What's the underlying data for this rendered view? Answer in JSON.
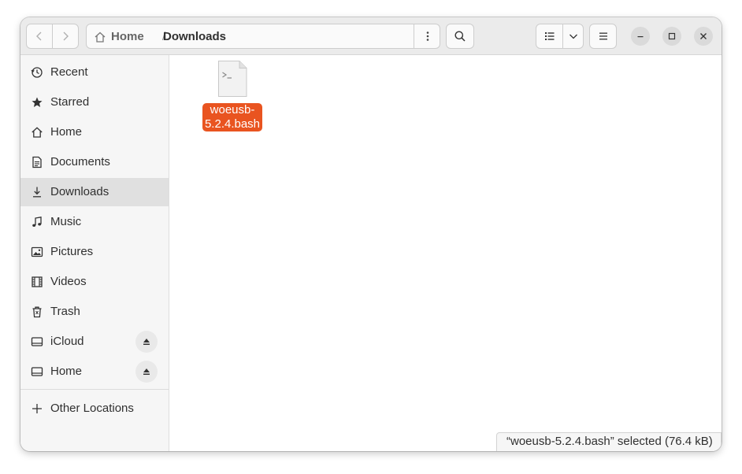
{
  "window": {
    "path": [
      "Home",
      "Downloads"
    ],
    "path_separator": "/"
  },
  "sidebar": {
    "items": [
      {
        "label": "Recent",
        "icon": "clock-icon"
      },
      {
        "label": "Starred",
        "icon": "star-icon"
      },
      {
        "label": "Home",
        "icon": "home-icon"
      },
      {
        "label": "Documents",
        "icon": "document-icon"
      },
      {
        "label": "Downloads",
        "icon": "download-icon",
        "selected": true
      },
      {
        "label": "Music",
        "icon": "music-note-icon"
      },
      {
        "label": "Pictures",
        "icon": "image-icon"
      },
      {
        "label": "Videos",
        "icon": "film-icon"
      },
      {
        "label": "Trash",
        "icon": "trash-icon"
      },
      {
        "label": "iCloud",
        "icon": "drive-icon",
        "ejectable": true
      },
      {
        "label": "Home",
        "icon": "drive-icon",
        "ejectable": true
      }
    ],
    "other_locations": {
      "label": "Other Locations",
      "icon": "plus-icon"
    }
  },
  "files": [
    {
      "name_lines": [
        "woeusb-",
        "5.2.4.bash"
      ],
      "icon": "terminal-script-icon",
      "selected": true
    }
  ],
  "status": {
    "text": "“woeusb-5.2.4.bash” selected  (76.4 kB)"
  },
  "colors": {
    "accent": "#e95420",
    "headerbar": "#ebebeb",
    "sidebar": "#f6f6f6",
    "selected_row": "#e0e0e0"
  }
}
